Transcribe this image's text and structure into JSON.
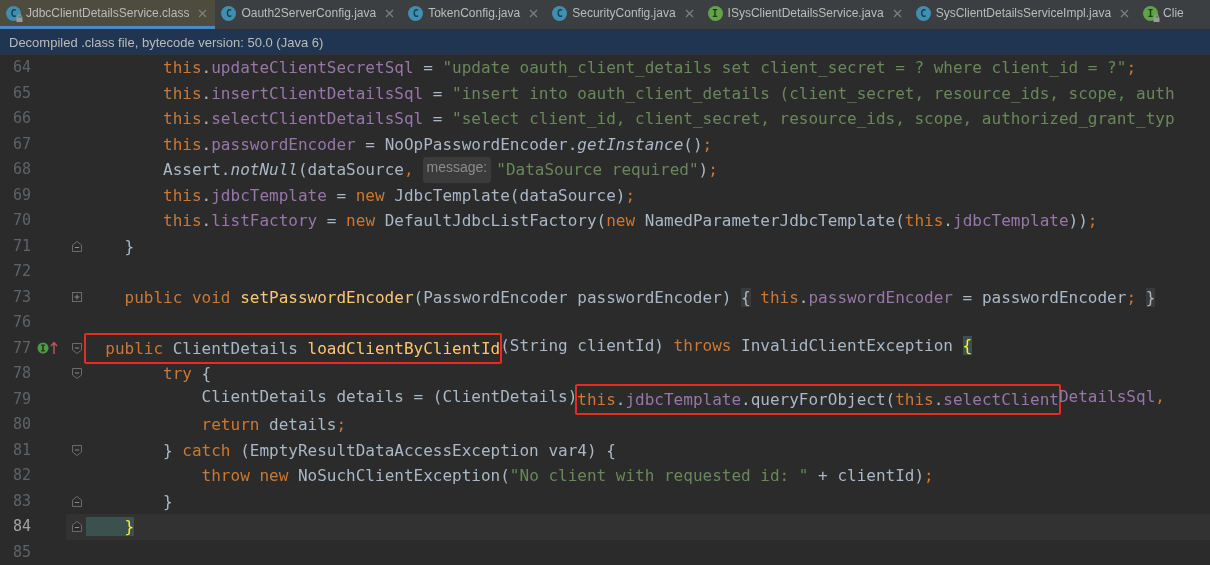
{
  "tabs": [
    {
      "label": "JdbcClientDetailsService.class",
      "icon": "C",
      "kind": "class",
      "locked": true,
      "selected": true
    },
    {
      "label": "Oauth2ServerConfig.java",
      "icon": "C",
      "kind": "class",
      "locked": false,
      "selected": false
    },
    {
      "label": "TokenConfig.java",
      "icon": "C",
      "kind": "class",
      "locked": false,
      "selected": false
    },
    {
      "label": "SecurityConfig.java",
      "icon": "C",
      "kind": "class",
      "locked": false,
      "selected": false
    },
    {
      "label": "ISysClientDetailsService.java",
      "icon": "I",
      "kind": "interface",
      "locked": false,
      "selected": false
    },
    {
      "label": "SysClientDetailsServiceImpl.java",
      "icon": "C",
      "kind": "class",
      "locked": false,
      "selected": false
    },
    {
      "label": "Clie",
      "icon": "I",
      "kind": "interface",
      "locked": true,
      "selected": false
    }
  ],
  "info_bar": "Decompiled .class file, bytecode version: 50.0 (Java 6)",
  "lines": [
    {
      "number": "64",
      "segments": [
        {
          "kind": "code",
          "tokens": [
            {
              "kind": "keyword",
              "text": "        this"
            },
            {
              "kind": "plain",
              "text": "."
            },
            {
              "kind": "field",
              "text": "updateClientSecretSql"
            },
            {
              "kind": "plain",
              "text": " = "
            },
            {
              "kind": "string",
              "text": "\"update oauth_client_details set client_secret = ? where client_id = ?\""
            },
            {
              "kind": "keyword",
              "text": ";"
            }
          ]
        }
      ]
    },
    {
      "number": "65",
      "segments": [
        {
          "kind": "code",
          "tokens": [
            {
              "kind": "keyword",
              "text": "        this"
            },
            {
              "kind": "plain",
              "text": "."
            },
            {
              "kind": "field",
              "text": "insertClientDetailsSql"
            },
            {
              "kind": "plain",
              "text": " = "
            },
            {
              "kind": "string",
              "text": "\"insert into oauth_client_details (client_secret, resource_ids, scope, auth"
            }
          ]
        }
      ]
    },
    {
      "number": "66",
      "segments": [
        {
          "kind": "code",
          "tokens": [
            {
              "kind": "keyword",
              "text": "        this"
            },
            {
              "kind": "plain",
              "text": "."
            },
            {
              "kind": "field",
              "text": "selectClientDetailsSql"
            },
            {
              "kind": "plain",
              "text": " = "
            },
            {
              "kind": "string",
              "text": "\"select client_id, client_secret, resource_ids, scope, authorized_grant_typ"
            }
          ]
        }
      ]
    },
    {
      "number": "67",
      "segments": [
        {
          "kind": "code",
          "tokens": [
            {
              "kind": "keyword",
              "text": "        this"
            },
            {
              "kind": "plain",
              "text": "."
            },
            {
              "kind": "field",
              "text": "passwordEncoder"
            },
            {
              "kind": "plain",
              "text": " = NoOpPasswordEncoder."
            },
            {
              "kind": "italic",
              "text": "getInstance"
            },
            {
              "kind": "plain",
              "text": "()"
            },
            {
              "kind": "keyword",
              "text": ";"
            }
          ]
        }
      ]
    },
    {
      "number": "68",
      "segments": [
        {
          "kind": "code",
          "tokens": [
            {
              "kind": "plain",
              "text": "        Assert."
            },
            {
              "kind": "italic",
              "text": "notNull"
            },
            {
              "kind": "plain",
              "text": "(dataSource"
            },
            {
              "kind": "keyword",
              "text": ","
            }
          ]
        },
        {
          "kind": "hint",
          "tokens": [
            {
              "kind": "hint",
              "text": "message:"
            }
          ]
        },
        {
          "kind": "code",
          "tokens": [
            {
              "kind": "string",
              "text": "\"DataSource required\""
            },
            {
              "kind": "plain",
              "text": ")"
            },
            {
              "kind": "keyword",
              "text": ";"
            }
          ]
        }
      ]
    },
    {
      "number": "69",
      "segments": [
        {
          "kind": "code",
          "tokens": [
            {
              "kind": "keyword",
              "text": "        this"
            },
            {
              "kind": "plain",
              "text": "."
            },
            {
              "kind": "field",
              "text": "jdbcTemplate"
            },
            {
              "kind": "plain",
              "text": " = "
            },
            {
              "kind": "keyword",
              "text": "new"
            },
            {
              "kind": "plain",
              "text": " JdbcTemplate(dataSource)"
            },
            {
              "kind": "keyword",
              "text": ";"
            }
          ]
        }
      ]
    },
    {
      "number": "70",
      "segments": [
        {
          "kind": "code",
          "tokens": [
            {
              "kind": "keyword",
              "text": "        this"
            },
            {
              "kind": "plain",
              "text": "."
            },
            {
              "kind": "field",
              "text": "listFactory"
            },
            {
              "kind": "plain",
              "text": " = "
            },
            {
              "kind": "keyword",
              "text": "new"
            },
            {
              "kind": "plain",
              "text": " DefaultJdbcListFactory("
            },
            {
              "kind": "keyword",
              "text": "new"
            },
            {
              "kind": "plain",
              "text": " NamedParameterJdbcTemplate("
            },
            {
              "kind": "keyword",
              "text": "this"
            },
            {
              "kind": "plain",
              "text": "."
            },
            {
              "kind": "field",
              "text": "jdbcTemplate"
            },
            {
              "kind": "plain",
              "text": "))"
            },
            {
              "kind": "keyword",
              "text": ";"
            }
          ]
        }
      ]
    },
    {
      "number": "71",
      "gutter": [
        {
          "kind": "fold_end"
        }
      ],
      "segments": [
        {
          "kind": "code",
          "tokens": [
            {
              "kind": "plain",
              "text": "    }"
            }
          ]
        }
      ]
    },
    {
      "number": "72"
    },
    {
      "number": "73",
      "gutter": [
        {
          "kind": "folded"
        }
      ],
      "segments": [
        {
          "kind": "code",
          "tokens": [
            {
              "kind": "keyword",
              "text": "    public void "
            },
            {
              "kind": "method",
              "text": "setPasswordEncoder"
            },
            {
              "kind": "plain",
              "text": "(PasswordEncoder passwordEncoder) "
            },
            {
              "kind": "fold",
              "text": "{"
            },
            {
              "kind": "keyword",
              "text": " this"
            },
            {
              "kind": "plain",
              "text": "."
            },
            {
              "kind": "field",
              "text": "passwordEncoder"
            },
            {
              "kind": "plain",
              "text": " = passwordEncoder"
            },
            {
              "kind": "keyword",
              "text": "; "
            },
            {
              "kind": "fold",
              "text": "}"
            }
          ]
        }
      ]
    },
    {
      "number": "76"
    },
    {
      "number": "77",
      "gutter": [
        {
          "kind": "implements"
        },
        {
          "kind": "fold_start"
        }
      ],
      "segments": [
        {
          "kind": "boxed",
          "tokens": [
            {
              "kind": "keyword",
              "text": "  public"
            },
            {
              "kind": "plain",
              "text": " ClientDetails "
            },
            {
              "kind": "method",
              "text": "loadClientByClientId"
            }
          ]
        },
        {
          "kind": "code",
          "tokens": [
            {
              "kind": "plain",
              "text": "(String clientId) "
            },
            {
              "kind": "keyword",
              "text": "throws"
            },
            {
              "kind": "plain",
              "text": " InvalidClientException "
            },
            {
              "kind": "match",
              "text": "{"
            }
          ]
        }
      ]
    },
    {
      "number": "78",
      "gutter": [
        {
          "kind": "fold_start"
        }
      ],
      "segments": [
        {
          "kind": "code",
          "tokens": [
            {
              "kind": "keyword",
              "text": "        try"
            },
            {
              "kind": "plain",
              "text": " {"
            }
          ]
        }
      ]
    },
    {
      "number": "79",
      "segments": [
        {
          "kind": "code",
          "tokens": [
            {
              "kind": "plain",
              "text": "            ClientDetails details = (ClientDetails)"
            }
          ]
        },
        {
          "kind": "boxed",
          "tokens": [
            {
              "kind": "keyword",
              "text": "this"
            },
            {
              "kind": "plain",
              "text": "."
            },
            {
              "kind": "field",
              "text": "jdbcTemplate"
            },
            {
              "kind": "plain",
              "text": ".queryForObject("
            },
            {
              "kind": "keyword",
              "text": "this"
            },
            {
              "kind": "plain",
              "text": "."
            },
            {
              "kind": "field",
              "text": "selectClient"
            }
          ]
        },
        {
          "kind": "code",
          "tokens": [
            {
              "kind": "field",
              "text": "DetailsSql"
            },
            {
              "kind": "keyword",
              "text": ","
            }
          ]
        }
      ]
    },
    {
      "number": "80",
      "segments": [
        {
          "kind": "code",
          "tokens": [
            {
              "kind": "keyword",
              "text": "            return"
            },
            {
              "kind": "plain",
              "text": " details"
            },
            {
              "kind": "keyword",
              "text": ";"
            }
          ]
        }
      ]
    },
    {
      "number": "81",
      "gutter": [
        {
          "kind": "fold_start"
        }
      ],
      "segments": [
        {
          "kind": "code",
          "tokens": [
            {
              "kind": "plain",
              "text": "        } "
            },
            {
              "kind": "keyword",
              "text": "catch"
            },
            {
              "kind": "plain",
              "text": " (EmptyResultDataAccessException var4) {"
            }
          ]
        }
      ]
    },
    {
      "number": "82",
      "segments": [
        {
          "kind": "code",
          "tokens": [
            {
              "kind": "keyword",
              "text": "            throw new"
            },
            {
              "kind": "plain",
              "text": " NoSuchClientException("
            },
            {
              "kind": "string",
              "text": "\"No client with requested id: \""
            },
            {
              "kind": "plain",
              "text": " + clientId)"
            },
            {
              "kind": "keyword",
              "text": ";"
            }
          ]
        }
      ]
    },
    {
      "number": "83",
      "gutter": [
        {
          "kind": "fold_end"
        }
      ],
      "segments": [
        {
          "kind": "code",
          "tokens": [
            {
              "kind": "plain",
              "text": "        }"
            }
          ]
        }
      ]
    },
    {
      "number": "84",
      "gutter": [
        {
          "kind": "fold_end"
        }
      ],
      "current": true,
      "segments": [
        {
          "kind": "code",
          "tokens": [
            {
              "kind": "match",
              "text": "    }"
            }
          ]
        }
      ]
    },
    {
      "number": "85"
    }
  ]
}
